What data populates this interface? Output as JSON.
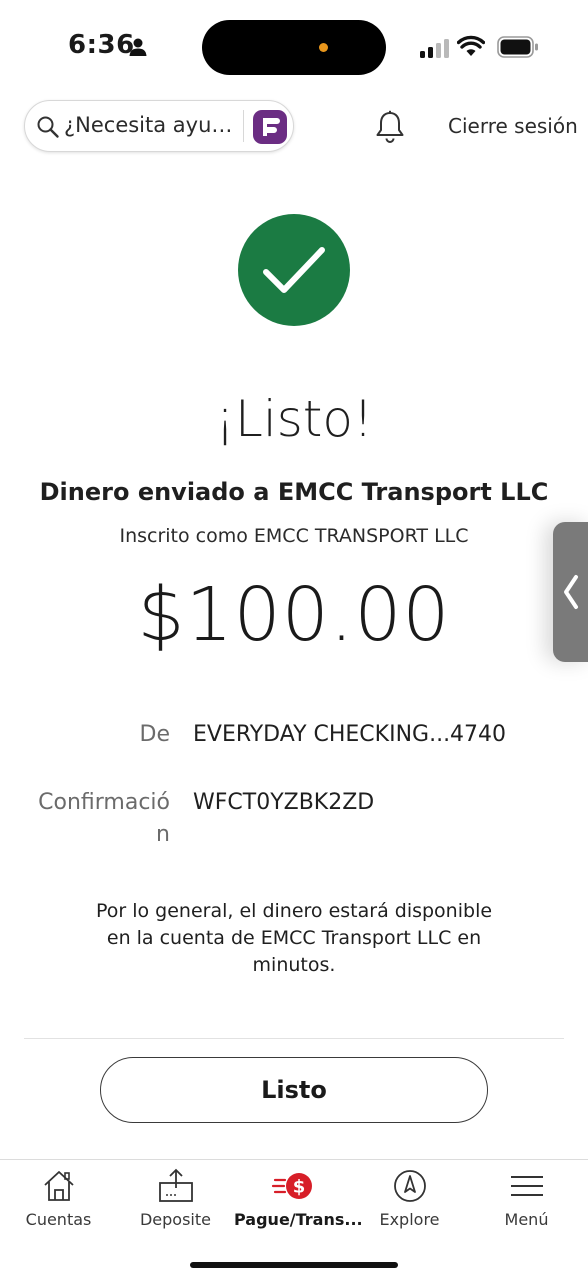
{
  "status_bar": {
    "time": "6:36"
  },
  "header": {
    "search_placeholder": "¿Necesita ayu…",
    "signout_label": "Cierre sesión"
  },
  "confirmation": {
    "headline": "¡Listo!",
    "sent_to": "Dinero enviado a EMCC Transport LLC",
    "enrolled_as": "Inscrito como EMCC TRANSPORT LLC",
    "amount": "$100.00",
    "from_label": "De",
    "from_value": "EVERYDAY CHECKING...4740",
    "confirmation_label": "Confirmació\nn",
    "confirmation_value": "WFCT0YZBK2ZD",
    "note": "Por lo general, el dinero estará disponible en la cuenta de EMCC Transport LLC en minutos.",
    "done_label": "Listo"
  },
  "bottom_nav": [
    {
      "label": "Cuentas",
      "icon": "home-icon"
    },
    {
      "label": "Deposite",
      "icon": "deposit-icon"
    },
    {
      "label": "Pague/Trans...",
      "icon": "pay-transfer-icon",
      "active": true
    },
    {
      "label": "Explore",
      "icon": "compass-icon"
    },
    {
      "label": "Menú",
      "icon": "menu-icon"
    }
  ],
  "colors": {
    "success_green": "#1b7b43",
    "brand_red": "#d71e28",
    "fargo_purple": "#6b2d83"
  }
}
